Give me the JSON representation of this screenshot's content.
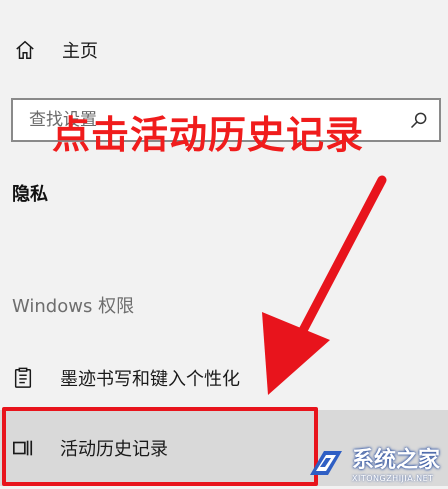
{
  "nav": {
    "home_label": "主页",
    "home_icon": "home-icon"
  },
  "search": {
    "placeholder": "查找设置",
    "icon": "search-icon"
  },
  "section": {
    "title": "隐私",
    "category": "Windows 权限"
  },
  "items": [
    {
      "label": "墨迹书写和键入个性化",
      "icon": "clipboard-icon"
    },
    {
      "label": "活动历史记录",
      "icon": "activity-history-icon",
      "selected": true
    }
  ],
  "annotation": {
    "text": "点击活动历史记录",
    "color": "#f01c1c"
  },
  "watermark": {
    "brand": "系统之家",
    "url": "XITONGZHIJIA.NET"
  },
  "colors": {
    "background": "#f2f2f2",
    "selected": "#d9d9d9",
    "highlight": "#e8141c"
  }
}
